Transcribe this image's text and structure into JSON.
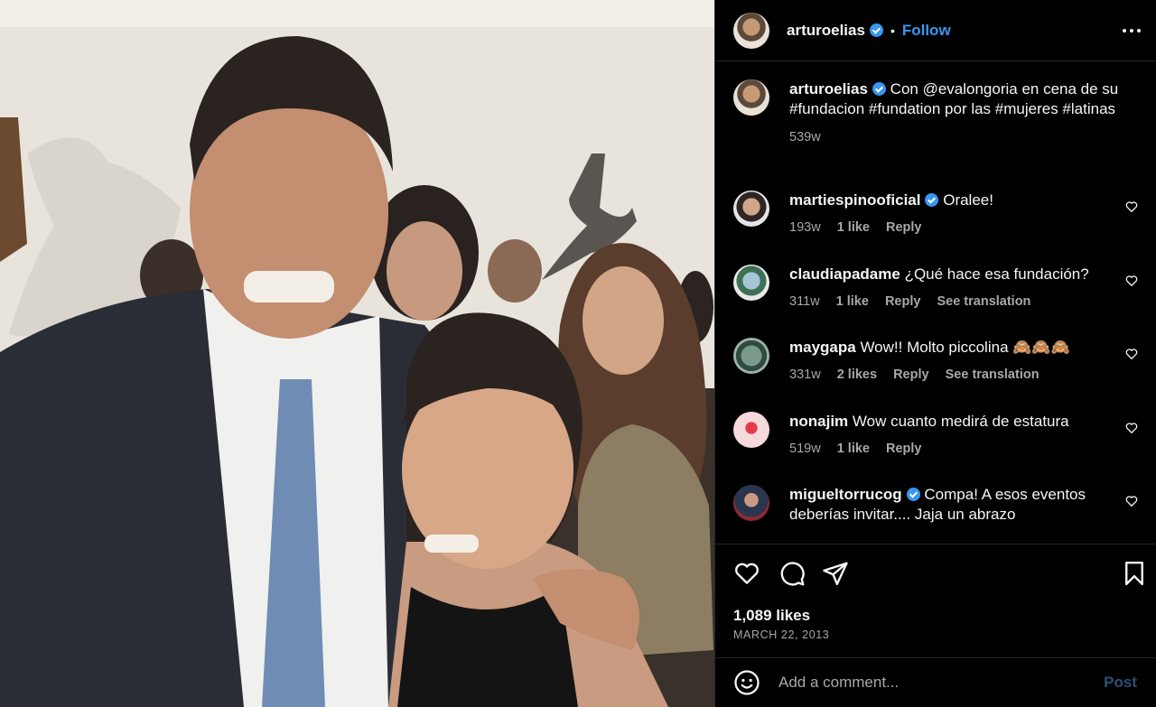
{
  "post": {
    "username": "arturoelias",
    "follow_label": "Follow",
    "dot": "•",
    "caption": "Con @evalongoria en cena de su #fundacion #fundation por las #mujeres #latinas",
    "caption_age": "539w"
  },
  "comments": [
    {
      "user": "martiespinooficial",
      "verified": true,
      "text": "Oralee!",
      "age": "193w",
      "likes": "1 like",
      "reply": "Reply",
      "translation": ""
    },
    {
      "user": "claudiapadame",
      "verified": false,
      "text": "¿Qué hace esa fundación?",
      "age": "311w",
      "likes": "1 like",
      "reply": "Reply",
      "translation": "See translation"
    },
    {
      "user": "maygapa",
      "verified": false,
      "text": "Wow!! Molto piccolina 🙈🙈🙈",
      "age": "331w",
      "likes": "2 likes",
      "reply": "Reply",
      "translation": "See translation"
    },
    {
      "user": "nonajim",
      "verified": false,
      "text": "Wow cuanto medirá de estatura",
      "age": "519w",
      "likes": "1 like",
      "reply": "Reply",
      "translation": ""
    },
    {
      "user": "migueltorrucog",
      "verified": true,
      "text": "Compa! A esos eventos deberías invitar.... Jaja un abrazo",
      "age": "",
      "likes": "",
      "reply": "",
      "translation": ""
    }
  ],
  "actions": {
    "likes_count": "1,089 likes",
    "date": "MARCH 22, 2013",
    "icons": [
      "heart-icon",
      "comment-icon",
      "share-icon",
      "bookmark-icon"
    ]
  },
  "add_comment": {
    "placeholder": "Add a comment...",
    "post_label": "Post"
  },
  "colors": {
    "accent": "#3797f0",
    "background": "#000000",
    "secondary_text": "#a8a8a8",
    "divider": "#262626"
  }
}
